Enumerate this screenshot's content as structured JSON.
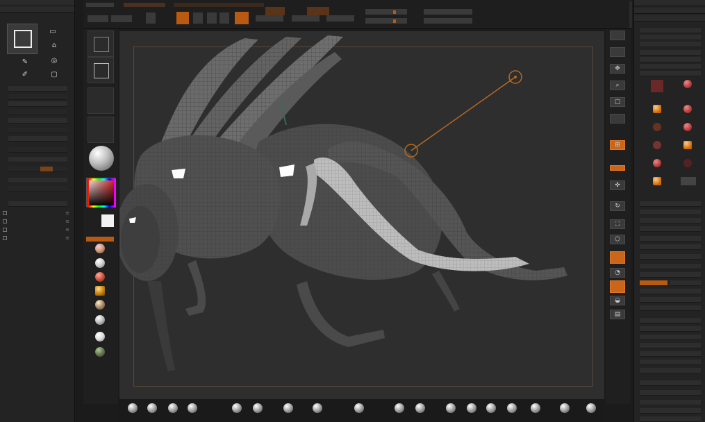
{
  "colors": {
    "accent": "#c9661a",
    "background": "#1b1b1b",
    "canvas": "#2e2e2e",
    "panel": "#232323"
  },
  "left_panel": {
    "header_items": [
      "",
      ""
    ],
    "sub_palettes": []
  },
  "top_bar": {
    "labels": []
  },
  "left_shelf": {
    "labels": []
  },
  "right_shelf": {
    "icons": [
      "cube-icon",
      "grid-icon",
      "move-icon",
      "scale-icon",
      "rotate-icon",
      "frame-icon",
      "polyframe-icon",
      "solo-icon",
      "transparency-icon",
      "ghost-icon",
      "xpose-icon"
    ]
  },
  "right_panel": {
    "headers": [],
    "rows": []
  },
  "bottom_shelf": {
    "brush_icons": [
      "brush-icon",
      "brush-icon",
      "brush-icon",
      "brush-icon",
      "brush-icon",
      "brush-icon",
      "brush-icon",
      "brush-icon",
      "brush-icon",
      "brush-icon",
      "brush-icon",
      "brush-icon",
      "brush-icon",
      "brush-icon",
      "brush-icon",
      "brush-icon",
      "brush-icon",
      "brush-icon"
    ]
  }
}
